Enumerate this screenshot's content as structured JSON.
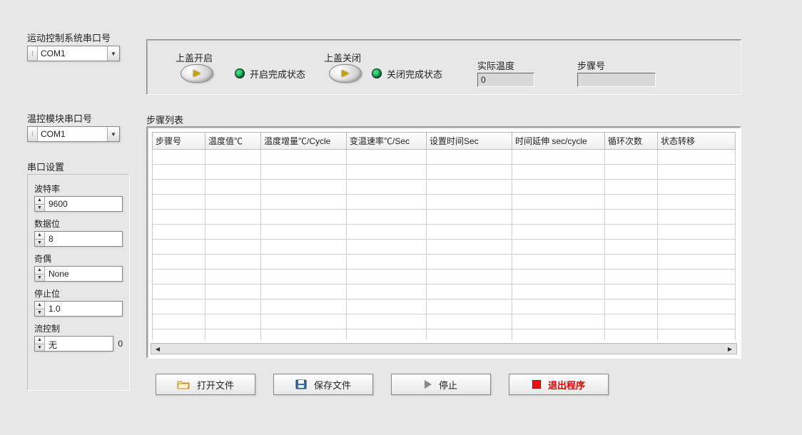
{
  "labels": {
    "motionPort": "运动控制系统串口号",
    "tempPort": "温控模块串口号",
    "serialSettings": "串口设置",
    "baud": "波特率",
    "dataBits": "数据位",
    "parity": "奇偶",
    "stopBits": "停止位",
    "flowCtrl": "流控制",
    "coverOpen": "上盖开启",
    "coverClose": "上盖关闭",
    "openDone": "开启完成状态",
    "closeDone": "关闭完成状态",
    "actualTemp": "实际温度",
    "stepNo": "步骤号",
    "stepList": "步骤列表"
  },
  "combos": {
    "motionPort": "COM1",
    "tempPort": "COM1"
  },
  "serial": {
    "baud": "9600",
    "dataBits": "8",
    "parity": "None",
    "stopBits": "1.0",
    "flowCtrl": "无",
    "flowCtrlSuffix": "0"
  },
  "status": {
    "actualTemp": "0",
    "stepNo": ""
  },
  "table": {
    "headers": [
      "步骤号",
      "温度值℃",
      "温度增量℃/Cycle",
      "变温速率℃/Sec",
      "设置时间Sec",
      "时间延伸 sec/cycle",
      "循环次数",
      "状态转移"
    ]
  },
  "buttons": {
    "open": "打开文件",
    "save": "保存文件",
    "stop": "停止",
    "exit": "退出程序"
  }
}
